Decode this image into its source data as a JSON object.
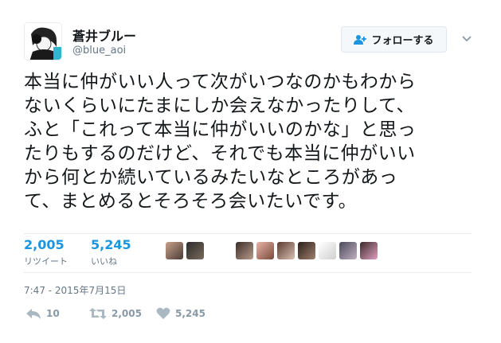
{
  "user": {
    "display_name": "蒼井ブルー",
    "screen_name": "@blue_aoi"
  },
  "follow_button": {
    "label": "フォローする"
  },
  "tweet": {
    "lines": [
      "本当に仲がいい人って次がいつなのかもわから",
      "ないくらいにたまにしか会えなかったりして、",
      "ふと「これって本当に仲がいいのかな」と思っ",
      "たりもするのだけど、それでも本当に仲がいい",
      "から何とか続いているみたいなところがあっ",
      "て、まとめるとそろそろ会いたいです。"
    ]
  },
  "stats": {
    "retweets": {
      "count": "2,005",
      "label": "リツイート"
    },
    "likes": {
      "count": "5,245",
      "label": "いいね"
    }
  },
  "timestamp": "7:47 - 2015年7月15日",
  "actions": {
    "reply_count": "10",
    "retweet_count": "2,005",
    "like_count": "5,245"
  },
  "colors": {
    "accent": "#1b95e0",
    "muted": "#657786"
  }
}
